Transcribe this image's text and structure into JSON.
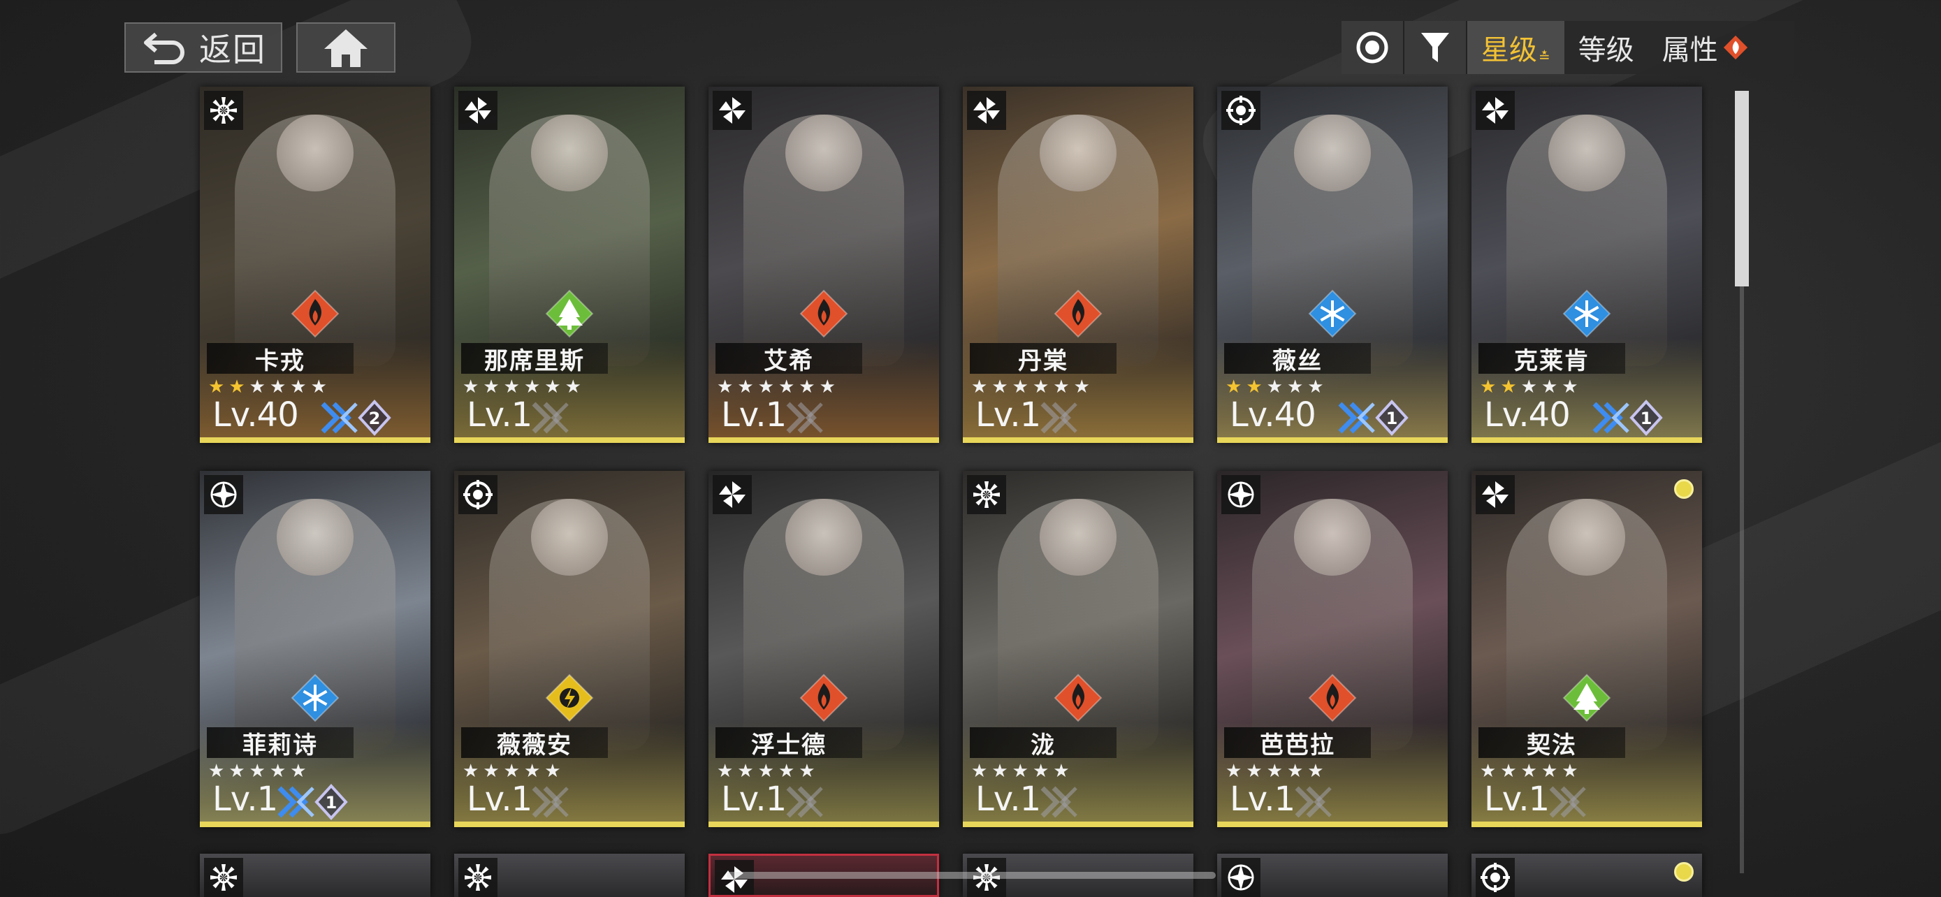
{
  "toolbar": {
    "back_label": "返回",
    "sort_options": [
      "星级",
      "等级",
      "属性"
    ],
    "active_sort": "星级"
  },
  "colors": {
    "fire": "#e0502a",
    "ice": "#2f8fe0",
    "nature": "#6cbe3a",
    "thunder": "#e5be1e",
    "sort_active": "#f3c234",
    "gold_strip": "#e8d65a"
  },
  "characters": [
    {
      "name": "卡戎",
      "level": "Lv.40",
      "stars": 6,
      "gold_stars": 2,
      "element": "fire",
      "class_icon": "burst-icon",
      "xborn": true,
      "rank": "2"
    },
    {
      "name": "那席里斯",
      "level": "Lv.1",
      "stars": 6,
      "gold_stars": 0,
      "element": "nature",
      "class_icon": "pinwheel-icon",
      "xborn": false,
      "rank": ""
    },
    {
      "name": "艾希",
      "level": "Lv.1",
      "stars": 6,
      "gold_stars": 0,
      "element": "fire",
      "class_icon": "pinwheel-icon",
      "xborn": false,
      "rank": ""
    },
    {
      "name": "丹棠",
      "level": "Lv.1",
      "stars": 6,
      "gold_stars": 0,
      "element": "fire",
      "class_icon": "pinwheel-icon",
      "xborn": false,
      "rank": ""
    },
    {
      "name": "薇丝",
      "level": "Lv.40",
      "stars": 5,
      "gold_stars": 2,
      "element": "ice",
      "class_icon": "crosshair-icon",
      "xborn": true,
      "rank": "1"
    },
    {
      "name": "克莱肯",
      "level": "Lv.40",
      "stars": 5,
      "gold_stars": 2,
      "element": "ice",
      "class_icon": "pinwheel-icon",
      "xborn": true,
      "rank": "1"
    },
    {
      "name": "菲莉诗",
      "level": "Lv.1",
      "stars": 5,
      "gold_stars": 0,
      "element": "ice",
      "class_icon": "compass-icon",
      "xborn": true,
      "rank": "1"
    },
    {
      "name": "薇薇安",
      "level": "Lv.1",
      "stars": 5,
      "gold_stars": 0,
      "element": "thunder",
      "class_icon": "crosshair-icon",
      "xborn": false,
      "rank": ""
    },
    {
      "name": "浮士德",
      "level": "Lv.1",
      "stars": 5,
      "gold_stars": 0,
      "element": "fire",
      "class_icon": "pinwheel-icon",
      "xborn": false,
      "rank": ""
    },
    {
      "name": "泷",
      "level": "Lv.1",
      "stars": 5,
      "gold_stars": 0,
      "element": "fire",
      "class_icon": "burst-icon",
      "xborn": false,
      "rank": ""
    },
    {
      "name": "芭芭拉",
      "level": "Lv.1",
      "stars": 5,
      "gold_stars": 0,
      "element": "fire",
      "class_icon": "compass-icon",
      "xborn": false,
      "rank": ""
    },
    {
      "name": "契法",
      "level": "Lv.1",
      "stars": 5,
      "gold_stars": 0,
      "element": "nature",
      "class_icon": "pinwheel-icon",
      "xborn": false,
      "rank": "",
      "new_dot": true
    }
  ],
  "partial_row_icons": [
    "burst-icon",
    "burst-icon",
    "pinwheel-icon",
    "burst-icon",
    "compass-icon",
    "crosshair-icon"
  ]
}
